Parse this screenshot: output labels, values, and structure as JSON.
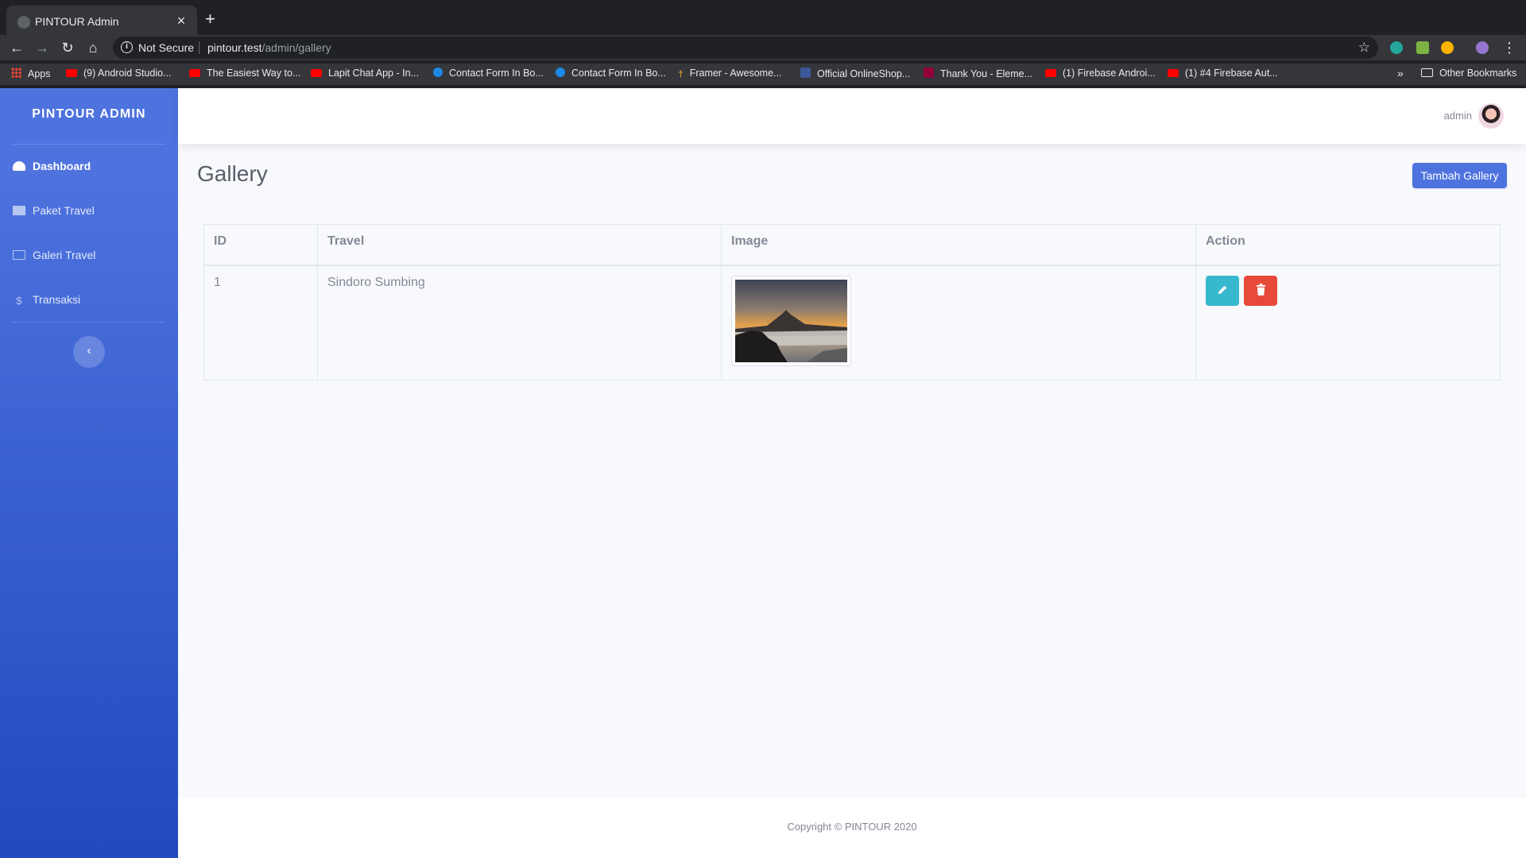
{
  "browser": {
    "tab_title": "PINTOUR Admin",
    "close_glyph": "×",
    "new_tab_glyph": "+",
    "security_label": "Not Secure",
    "url_host": "pintour.test",
    "url_path": "/admin/gallery",
    "bookmarks": [
      {
        "label": "Apps",
        "icon": "apps-icon"
      },
      {
        "label": "(9) Android Studio...",
        "icon": "youtube-icon"
      },
      {
        "label": "The Easiest Way to...",
        "icon": "youtube-icon"
      },
      {
        "label": "Lapit Chat App - In...",
        "icon": "youtube-icon"
      },
      {
        "label": "Contact Form In Bo...",
        "icon": "hexagon-icon"
      },
      {
        "label": "Contact Form In Bo...",
        "icon": "hexagon-icon"
      },
      {
        "label": "Framer - Awesome...",
        "icon": "framer-icon"
      },
      {
        "label": "Official OnlineShop...",
        "icon": "facebook-icon"
      },
      {
        "label": "Thank You - Eleme...",
        "icon": "elementor-icon"
      },
      {
        "label": "(1) Firebase Androi...",
        "icon": "youtube-icon"
      },
      {
        "label": "(1) #4 Firebase Aut...",
        "icon": "youtube-icon"
      }
    ],
    "bookmarks_more": "»",
    "other_bookmarks": "Other Bookmarks"
  },
  "sidebar": {
    "brand": "PINTOUR ADMIN",
    "items": [
      {
        "label": "Dashboard",
        "icon": "tachometer-icon",
        "active": true
      },
      {
        "label": "Paket Travel",
        "icon": "building-icon"
      },
      {
        "label": "Galeri Travel",
        "icon": "images-icon"
      },
      {
        "label": "Transaksi",
        "icon": "dollar-icon"
      }
    ],
    "toggle_glyph": "‹"
  },
  "topbar": {
    "user_name": "admin"
  },
  "main": {
    "title": "Gallery",
    "add_button": "Tambah Gallery",
    "table": {
      "headers": [
        "ID",
        "Travel",
        "Image",
        "Action"
      ],
      "rows": [
        {
          "id": "1",
          "travel": "Sindoro Sumbing",
          "image": "mountain sunrise thumbnail"
        }
      ]
    }
  },
  "footer": {
    "copyright": "Copyright © PINTOUR 2020"
  },
  "colors": {
    "primary": "#4e73df",
    "info": "#36b9cc",
    "danger": "#e74a3b",
    "text_gray": "#858796"
  }
}
